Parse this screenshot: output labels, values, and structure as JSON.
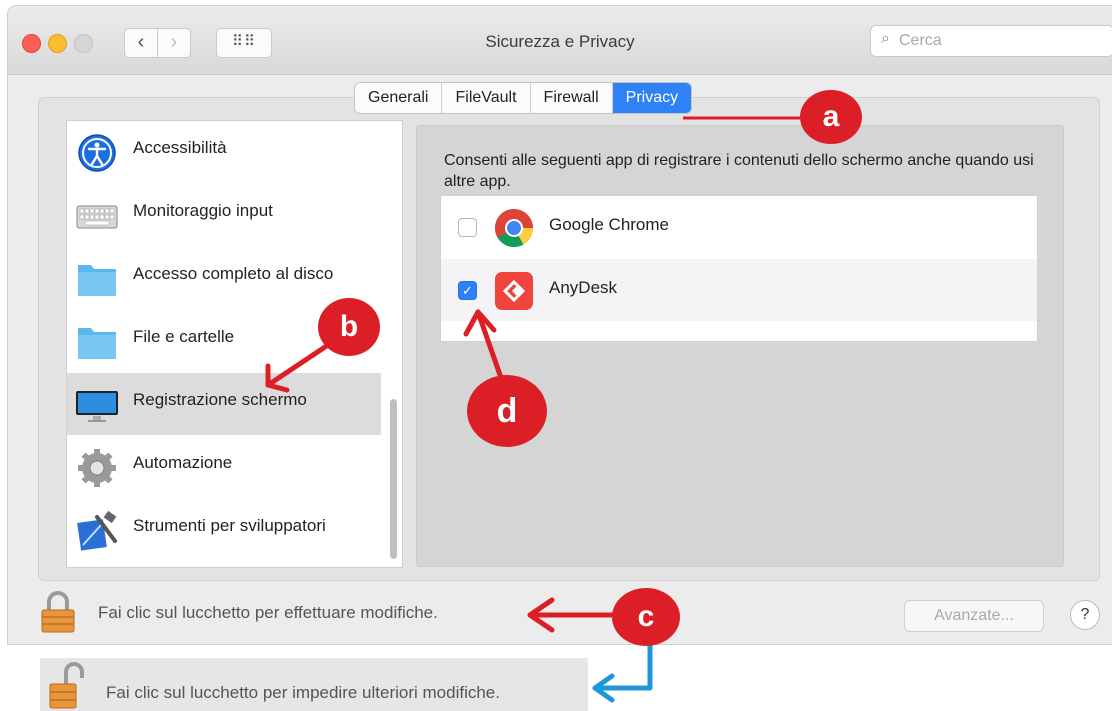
{
  "window": {
    "title": "Sicurezza e Privacy"
  },
  "search": {
    "placeholder": "Cerca",
    "icon": "search-icon"
  },
  "tabs": [
    {
      "label": "Generali",
      "active": false
    },
    {
      "label": "FileVault",
      "active": false
    },
    {
      "label": "Firewall",
      "active": false
    },
    {
      "label": "Privacy",
      "active": true
    }
  ],
  "sidebar": {
    "items": [
      {
        "label": "Accessibilità",
        "icon": "accessibility-icon"
      },
      {
        "label": "Monitoraggio input",
        "icon": "keyboard-icon"
      },
      {
        "label": "Accesso completo al disco",
        "icon": "folder-icon"
      },
      {
        "label": "File e cartelle",
        "icon": "folder-icon"
      },
      {
        "label": "Registrazione schermo",
        "icon": "monitor-icon",
        "selected": true
      },
      {
        "label": "Automazione",
        "icon": "gear-icon"
      },
      {
        "label": "Strumenti per sviluppatori",
        "icon": "developer-tools-icon"
      }
    ]
  },
  "main": {
    "description": "Consenti alle seguenti app di registrare i contenuti dello schermo anche quando usi altre app.",
    "apps": [
      {
        "name": "Google Chrome",
        "checked": false,
        "icon": "chrome-icon"
      },
      {
        "name": "AnyDesk",
        "checked": true,
        "icon": "anydesk-icon"
      }
    ]
  },
  "footer": {
    "lock_text": "Fai clic sul lucchetto per effettuare modifiche.",
    "advanced_label": "Avanzate...",
    "help_label": "?"
  },
  "unlocked_footer": {
    "lock_text": "Fai clic sul lucchetto per impedire ulteriori modifiche."
  },
  "annotations": {
    "a": "a",
    "b": "b",
    "c": "c",
    "d": "d",
    "red": "#dc1f27",
    "blue": "#1f96d8"
  },
  "colors": {
    "accent": "#2e82f5"
  }
}
